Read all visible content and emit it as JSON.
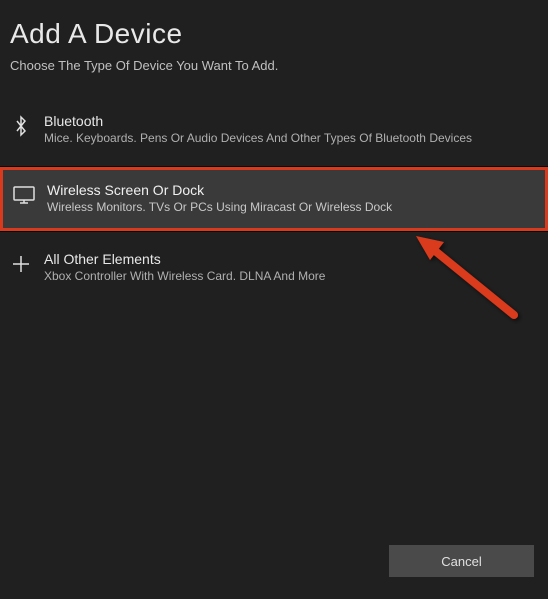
{
  "header": {
    "title": "Add A Device",
    "subtitle": "Choose The Type Of Device You Want To Add."
  },
  "options": {
    "bluetooth": {
      "title": "Bluetooth",
      "desc": "Mice. Keyboards. Pens Or Audio Devices And Other Types Of Bluetooth Devices"
    },
    "wireless": {
      "title": "Wireless Screen Or Dock",
      "desc": "Wireless Monitors. TVs Or PCs Using Miracast Or Wireless Dock"
    },
    "other": {
      "title": "All Other Elements",
      "desc": "Xbox Controller With Wireless Card. DLNA And More"
    }
  },
  "footer": {
    "cancel": "Cancel"
  }
}
